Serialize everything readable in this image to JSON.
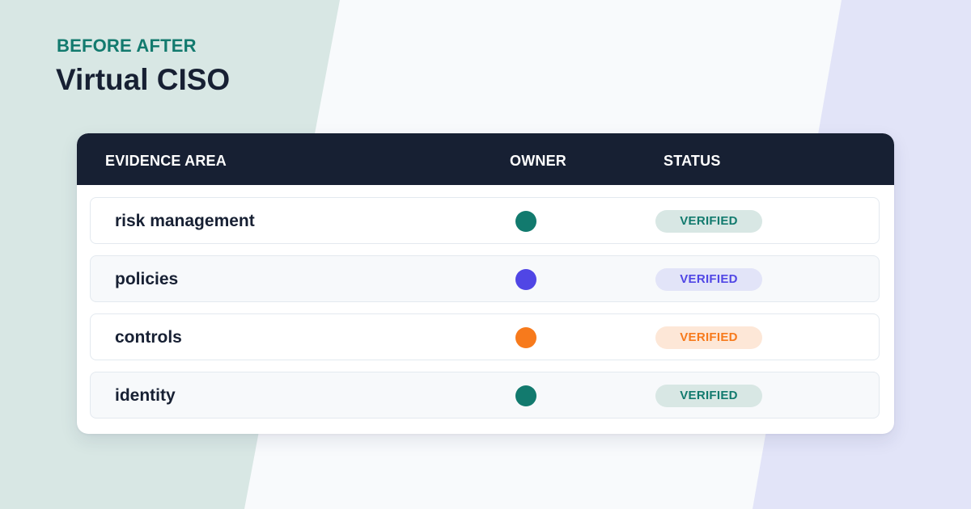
{
  "header": {
    "eyebrow": "BEFORE AFTER",
    "title": "Virtual CISO"
  },
  "table": {
    "columns": [
      "EVIDENCE AREA",
      "OWNER",
      "STATUS"
    ],
    "rows": [
      {
        "area": "risk management",
        "status": "VERIFIED",
        "owner_color": "#127a6e",
        "status_color": "#127a6e"
      },
      {
        "area": "policies",
        "status": "VERIFIED",
        "owner_color": "#5046e5",
        "status_color": "#5046e5"
      },
      {
        "area": "controls",
        "status": "VERIFIED",
        "owner_color": "#f77a1c",
        "status_color": "#f77a1c"
      },
      {
        "area": "identity",
        "status": "VERIFIED",
        "owner_color": "#127a6e",
        "status_color": "#127a6e"
      }
    ]
  },
  "colors": {
    "header_bg": "#172033",
    "accent_teal": "#127a6e",
    "accent_indigo": "#5046e5",
    "accent_orange": "#f77a1c",
    "bg_left_panel": "#d8e7e4",
    "bg_right_panel": "#e2e4f8"
  }
}
